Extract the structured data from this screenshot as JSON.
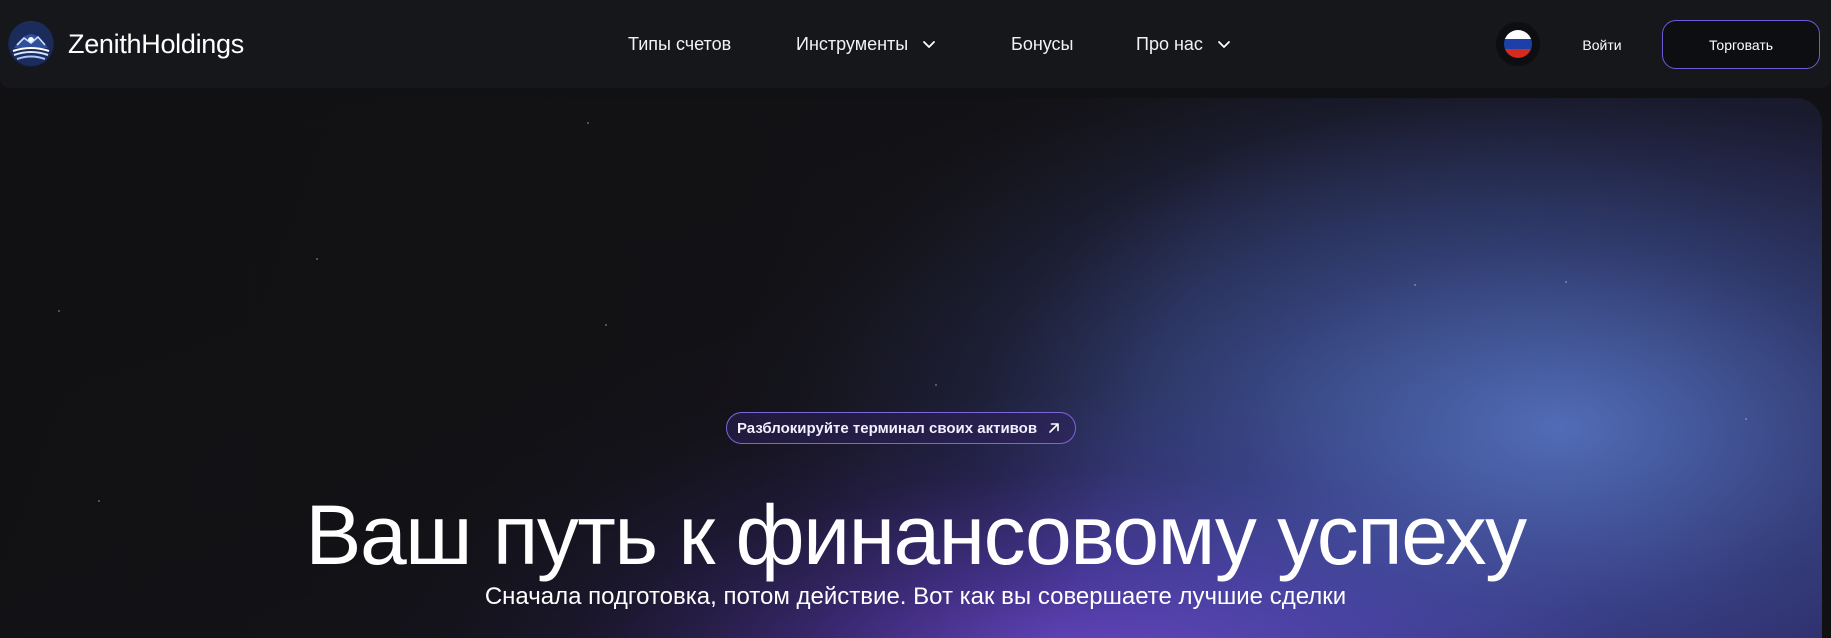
{
  "brand": {
    "name": "ZenithHoldings",
    "logo_icon": "zenith-wave-logo"
  },
  "nav": {
    "items": [
      {
        "label": "Типы счетов",
        "has_dropdown": false
      },
      {
        "label": "Инструменты",
        "has_dropdown": true
      },
      {
        "label": "Бонусы",
        "has_dropdown": false
      },
      {
        "label": "Про нас",
        "has_dropdown": true
      }
    ]
  },
  "header_actions": {
    "language_flag": "russia-flag-icon",
    "login_label": "Войти",
    "trade_label": "Торговать"
  },
  "hero": {
    "badge_label": "Разблокируйте терминал своих активов",
    "badge_icon": "arrow-up-right-icon",
    "title": "Ваш путь к финансовому успеху",
    "subtitle": "Сначала подготовка, потом действие. Вот как вы совершаете лучшие сделки"
  },
  "colors": {
    "background": "#111114",
    "header_bg": "#16171b",
    "accent_purple": "#6a5bd6",
    "glow_blue": "#6084dc",
    "glow_violet": "#7850dc"
  }
}
